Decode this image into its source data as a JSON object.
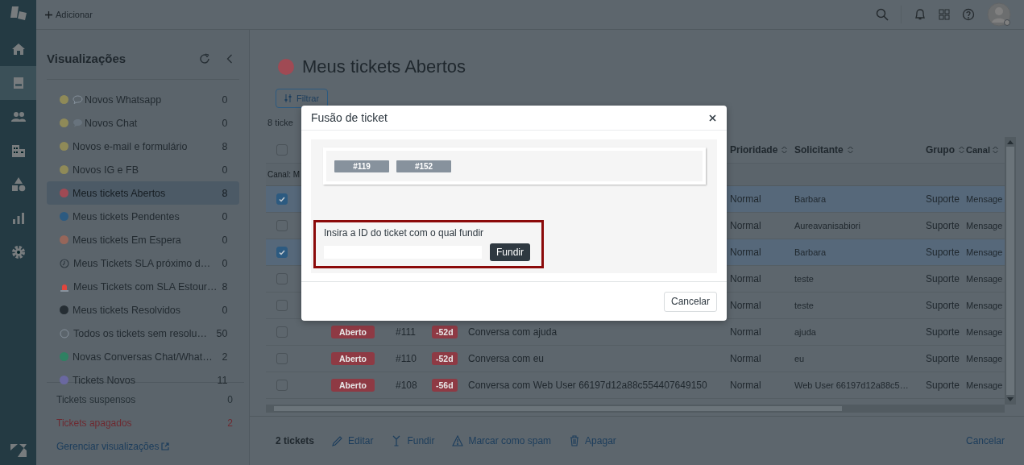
{
  "topbar": {
    "add_label": "Adicionar"
  },
  "nav": [
    {
      "kind": "home",
      "selected": false
    },
    {
      "kind": "tickets",
      "selected": true
    },
    {
      "kind": "users",
      "selected": false
    },
    {
      "kind": "buildings",
      "selected": false
    },
    {
      "kind": "shapes",
      "selected": false
    },
    {
      "kind": "chart",
      "selected": false
    },
    {
      "kind": "settings",
      "selected": false
    }
  ],
  "sidebar": {
    "title": "Visualizações",
    "views": [
      {
        "label": "Novos Whatsapp",
        "count": "0",
        "kind": "bubbledot",
        "color": "#8f8a58",
        "selected": false
      },
      {
        "label": "Novos Chat",
        "count": "0",
        "kind": "chatdot",
        "color": "#8f8a58",
        "selected": false
      },
      {
        "label": "Novos e-mail e formulário",
        "count": "8",
        "kind": "dot",
        "color": "#8f8a58",
        "selected": false
      },
      {
        "label": "Novos IG e FB",
        "count": "0",
        "kind": "dot",
        "color": "#8f8a58",
        "selected": false
      },
      {
        "label": "Meus tickets Abertos",
        "count": "8",
        "kind": "dot",
        "color": "#a04a54",
        "selected": true
      },
      {
        "label": "Meus tickets Pendentes",
        "count": "0",
        "kind": "dot",
        "color": "#2c5a80",
        "selected": false
      },
      {
        "label": "Meus tickets Em Espera",
        "count": "0",
        "kind": "dot",
        "color": "#96665a",
        "selected": false
      },
      {
        "label": "Meus Tickets SLA próximo d…",
        "count": "0",
        "kind": "clock",
        "selected": false
      },
      {
        "label": "Meus Tickets com SLA Estour…",
        "count": "8",
        "kind": "siren",
        "selected": false
      },
      {
        "label": "Meus tickets Resolvidos",
        "count": "0",
        "kind": "dot",
        "color": "#252d33",
        "selected": false
      },
      {
        "label": "Todos os tickets sem resolu…",
        "count": "50",
        "kind": "ring",
        "selected": false
      },
      {
        "label": "Novas Conversas Chat/What…",
        "count": "2",
        "kind": "dot",
        "color": "#2f8062",
        "selected": false
      },
      {
        "label": "Tickets Novos",
        "count": "11",
        "kind": "dot",
        "color": "#6a68a0",
        "selected": false
      }
    ],
    "footer_links": [
      {
        "label": "Tickets suspensos",
        "count": "0",
        "kind": "plain"
      },
      {
        "label": "Tickets apagados",
        "count": "2",
        "kind": "danger"
      }
    ],
    "manage_link": "Gerenciar visualizações"
  },
  "main": {
    "title": "Meus tickets Abertos",
    "title_dot": {
      "color": "#a04a54"
    },
    "filter_label": "Filtrar",
    "ticket_count": "8 ticke",
    "table": {
      "header_checked": false,
      "columns": [
        "Prioridade",
        "Solicitante",
        "Grupo",
        "Canal"
      ],
      "group_label": "Canal: M",
      "rows": [
        {
          "selected": true,
          "priority": "Normal",
          "requester": "Barbara",
          "group": "Suporte",
          "channel": "Mensage"
        },
        {
          "selected": false,
          "priority": "Normal",
          "requester": "Aureavanisabiori",
          "group": "Suporte",
          "channel": "Mensage"
        },
        {
          "selected": true,
          "priority": "Normal",
          "requester": "Barbara",
          "group": "Suporte",
          "channel": "Mensage"
        },
        {
          "selected": false,
          "priority": "Normal",
          "requester": "teste",
          "group": "Suporte",
          "channel": "Mensage"
        },
        {
          "selected": false,
          "priority": "Normal",
          "requester": "teste",
          "group": "Suporte",
          "channel": "Mensage"
        },
        {
          "selected": false,
          "status": "Aberto",
          "id": "#111",
          "age": "-52d",
          "subject": "Conversa com ajuda",
          "priority": "Normal",
          "requester": "ajuda",
          "group": "Suporte",
          "channel": "Mensage"
        },
        {
          "selected": false,
          "status": "Aberto",
          "id": "#110",
          "age": "-52d",
          "subject": "Conversa com eu",
          "priority": "Normal",
          "requester": "eu",
          "group": "Suporte",
          "channel": "Mensage"
        },
        {
          "selected": false,
          "status": "Aberto",
          "id": "#108",
          "age": "-56d",
          "subject": "Conversa com Web User 66197d12a88c554407649150",
          "priority": "Normal",
          "requester": "Web User 66197d12a88c5…",
          "group": "Suporte",
          "channel": "Mensage"
        }
      ]
    },
    "actions": {
      "count": "2 tickets",
      "items": [
        {
          "kind": "edit",
          "label": "Editar"
        },
        {
          "kind": "merge",
          "label": "Fundir"
        },
        {
          "kind": "spam",
          "label": "Marcar como spam"
        },
        {
          "kind": "delete",
          "label": "Apagar"
        }
      ],
      "cancel": "Cancelar"
    }
  },
  "modal": {
    "title": "Fusão de ticket",
    "tickets": [
      "#119",
      "#152"
    ],
    "label": "Insira a ID do ticket com o qual fundir",
    "submit": "Fundir",
    "cancel": "Cancelar"
  }
}
